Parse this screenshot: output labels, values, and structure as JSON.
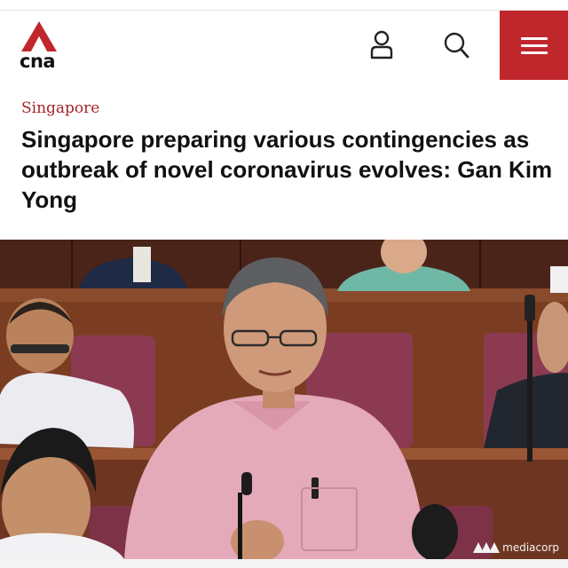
{
  "header": {
    "logo_text": "cna",
    "brand_color": "#c0272d",
    "icons": [
      "account-icon",
      "search-icon",
      "menu-icon"
    ]
  },
  "article": {
    "category": "Singapore",
    "headline": "Singapore preparing various contingencies as outbreak of novel coronavirus evolves: Gan Kim Yong"
  },
  "photo": {
    "watermark": "mediacorp"
  }
}
